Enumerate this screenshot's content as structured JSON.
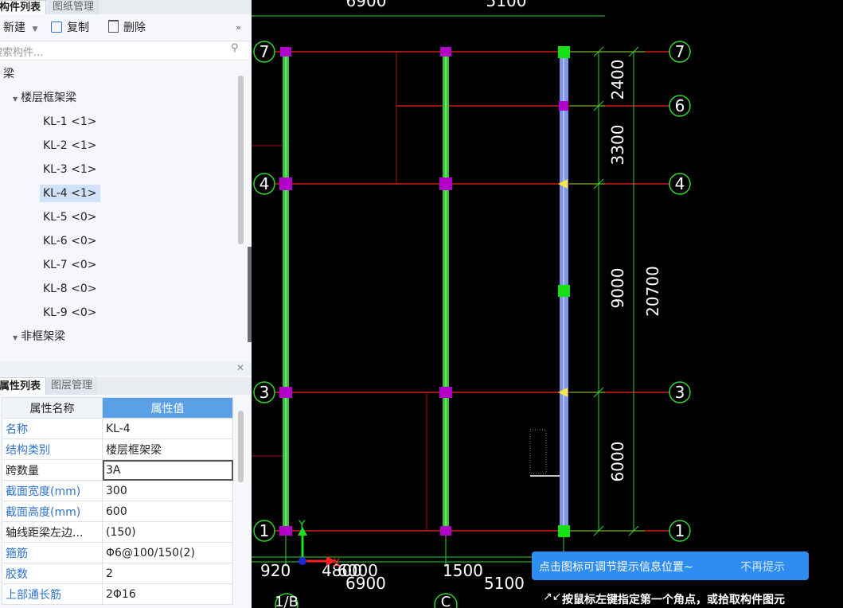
{
  "component_list": {
    "tabs": [
      "构件列表",
      "图纸管理"
    ],
    "toolbar": {
      "new": "新建",
      "copy": "复制",
      "delete": "删除"
    },
    "search_placeholder": "搜索构件...",
    "tree": {
      "root": "梁",
      "group1": "楼层框架梁",
      "items": [
        "KL-1 <1>",
        "KL-2 <1>",
        "KL-3 <1>",
        "KL-4 <1>",
        "KL-5 <0>",
        "KL-6 <0>",
        "KL-7 <0>",
        "KL-8 <0>",
        "KL-9 <0>"
      ],
      "selected_index": 3,
      "group2": "非框架梁"
    }
  },
  "properties": {
    "tabs": [
      "属性列表",
      "图层管理"
    ],
    "headers": {
      "name": "属性名称",
      "value": "属性值"
    },
    "rows": [
      {
        "name": "名称",
        "value": "KL-4"
      },
      {
        "name": "结构类别",
        "value": "楼层框架梁"
      },
      {
        "name": "跨数量",
        "value": "3A"
      },
      {
        "name": "截面宽度(mm)",
        "value": "300"
      },
      {
        "name": "截面高度(mm)",
        "value": "600"
      },
      {
        "name": "轴线距梁左边...",
        "value": "(150)"
      },
      {
        "name": "箍筋",
        "value": "Φ6@100/150(2)"
      },
      {
        "name": "胶数",
        "value": "2"
      },
      {
        "name": "上部通长筋",
        "value": "2Φ16"
      }
    ]
  },
  "canvas": {
    "top_dims": [
      "6900",
      "5100"
    ],
    "axis_labels": [
      "7",
      "6",
      "4",
      "3",
      "1"
    ],
    "right_dims": [
      "2400",
      "3300",
      "9000",
      "6000"
    ],
    "total_dim": "20700",
    "bottom_dims": [
      "920",
      "4800",
      "6000",
      "6900",
      "1500",
      "5100"
    ],
    "bottom_axes": [
      "1/B",
      "C"
    ],
    "ucs": {
      "x": "X",
      "y": "Y"
    }
  },
  "tip": {
    "message": "点击图标可调节提示信息位置~",
    "dismiss": "不再提示"
  },
  "status": {
    "text": "按鼠标左键指定第一个角点，或拾取构件图元"
  },
  "colors": {
    "beam_green": "#3cc13c",
    "beam_blue": "#7d95e8",
    "axis_red": "#d11b1b",
    "dim_green": "#2fd42f",
    "column_magenta": "#b100c8",
    "accent_blue": "#2f8cf1"
  }
}
